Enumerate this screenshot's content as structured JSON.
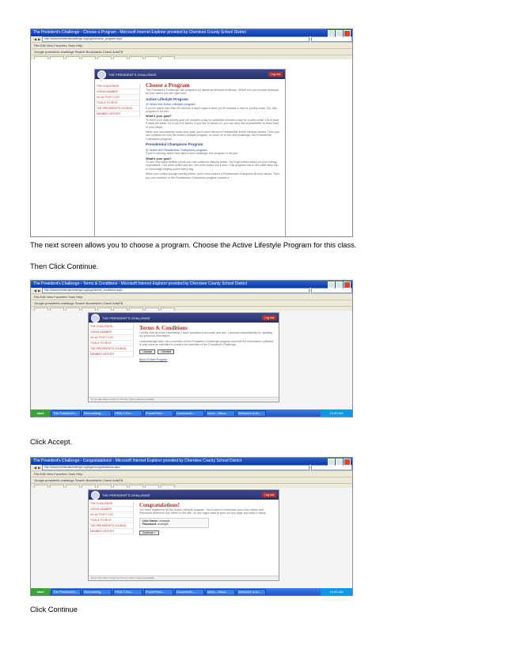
{
  "captions": {
    "c1": "The next screen allows you to choose a program.  Choose the Active Lifestyle Program for this class.",
    "c2": "Then Click Continue.",
    "c3": "Click Accept.",
    "c4": "Click Continue"
  },
  "shot1": {
    "window_title": "The President's Challenge - Choose a Program - Microsoft Internet Explorer provided by Cherokee County School District",
    "address": "http://www.presidentschallenge.org/login/choose_program.aspx",
    "menu": "File  Edit  View  Favorites  Tools  Help",
    "links": "Google  presidents challenge    Search   Bookmarks   Check   AutoFill",
    "site_brand": "THE PRESIDENT'S CHALLENGE",
    "logout": "Log out",
    "nav": [
      "THE CHALLENGE",
      "GOING NUMBER",
      "MY ACTIVITY LOG",
      "TOOLS TO HELP",
      "THE PRESIDENT'S COUNCIL",
      "MEMBER CENTER"
    ],
    "heading": "Choose a Program",
    "intro": "The President's Challenge has programs for adults at all levels of fitness. Which one you choose depends on how active you are right now.",
    "sec1_title": "Active Lifestyle Program",
    "sec1_option": "Select the Active Lifestyle program",
    "sec1_option_note": "If you're active less than 30 minutes a day/5 days a week (or 60 minutes a day for youths under 18), this program is for you.",
    "sec1_goal_label": "What's your goal?",
    "sec1_goal": "To meet your daily activity goal (30 minutes a day for adults/60 minutes a day for youths under 18) at least 5 days per week, for 6 out of 8 weeks. If you like to switch on, you can also use a pedometer to keep track of your steps.",
    "sec1_reach": "When you successfully reach your goal, you'll have earned a Presidential Active Lifestyle Award. Then you can continue on with the Active Lifestyle program, or move on to the next challenge: the Presidential Champions program.",
    "sec2_title": "Presidential Champions Program",
    "sec2_option": "Select the Presidential Champions program",
    "sec2_option_note": "If you're already active and want a new challenge, this program is for you.",
    "sec2_goal_label": "What's your goal?",
    "sec2_goal": "To see how many activity points you can collect for staying active. You'll get points based on your energy expenditure. The more active you are, the more points you'll earn. This program has a 100-point daily cap to encourage staying active every day.",
    "sec2_reach": "When you collect enough activity points, you'll have earned a Presidential Champions Bronze award. Then you can continue in the Presidential Champions program toward a"
  },
  "shot2": {
    "window_title": "The President's Challenge - Terms & Conditions - Microsoft Internet Explorer provided by Cherokee County School District",
    "address": "http://www.presidentschallenge.org/login/terms_conditions.aspx",
    "menu": "File  Edit  View  Favorites  Tools  Help",
    "links": "Google  presidents challenge    Search   Bookmarks   Check   AutoFill",
    "site_brand": "THE PRESIDENT'S CHALLENGE",
    "logout": "Log out",
    "nav": [
      "THE CHALLENGE",
      "GOING NUMBER",
      "MY ACTIVITY LOG",
      "TOOLS TO HELP",
      "THE PRESIDENT'S COUNCIL",
      "MEMBER CENTER"
    ],
    "heading": "Terms & Conditions",
    "p1": "I certify that all of the information I have provided is accurate and true. I assume responsibility for updating my personal information.",
    "p2": "I acknowledge that I am a member of the President's Challenge program and that the information collected is only used as intended to monitor the activities of the President's Challenge.",
    "accept": "I Accept",
    "decline": "I Decline",
    "back": "Back to Main Program",
    "footer": "Home   Site Map   Contact Us   Privacy Policy   Help   Accessibility"
  },
  "shot3": {
    "window_title": "The President's Challenge - Congratulations! - Microsoft Internet Explorer provided by Cherokee County School District",
    "address": "http://www.presidentschallenge.org/login/congratulations.aspx",
    "menu": "File  Edit  View  Favorites  Tools  Help",
    "links": "Google  presidents challenge    Search   Bookmarks   Check   AutoFill",
    "site_brand": "THE PRESIDENT'S CHALLENGE",
    "logout": "Log out",
    "nav": [
      "THE CHALLENGE",
      "GOING NUMBER",
      "MY ACTIVITY LOG",
      "TOOLS TO HELP",
      "THE PRESIDENT'S COUNCIL",
      "MEMBER CENTER"
    ],
    "heading": "Congratulations!",
    "p1": "You have registered for the Active Lifestyle program. You'll need to remember your User Name and Password whenever you return to the site, so you might want to print out this page and keep it handy.",
    "user_label": "User Name:",
    "user_value": "example",
    "pass_label": "Password:",
    "pass_value": "example",
    "continue": "Continue >",
    "footer": "Home   Site Map   Contact Us   Privacy Policy   Help   Accessibility"
  },
  "taskbar": {
    "start": "start",
    "items": [
      "The President's...",
      "Remodeling...",
      "PRALT Evo...",
      "PowerPoint...",
      "Document1...",
      "Inbox - Micro...",
      "Welcome to th..."
    ],
    "clock": "10:45 AM"
  }
}
